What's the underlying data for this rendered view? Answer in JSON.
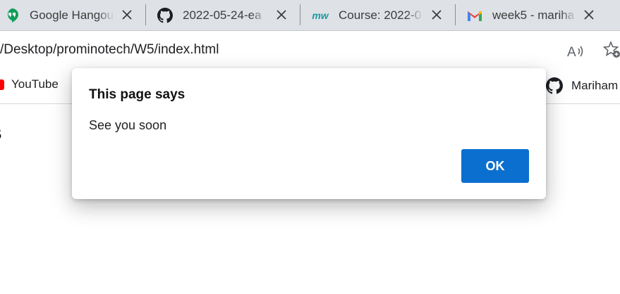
{
  "tabs": [
    {
      "title": "Google Hangouts",
      "icon": "google-hangouts-icon"
    },
    {
      "title": "2022-05-24-ea",
      "icon": "github-icon"
    },
    {
      "title": "Course: 2022-0",
      "icon": "mw-logo-icon",
      "icon_text": "mw"
    },
    {
      "title": "week5 - mariha",
      "icon": "gmail-icon"
    }
  ],
  "address_bar": {
    "url": "/Desktop/prominotech/W5/index.html"
  },
  "bookmarks": [
    {
      "label": "YouTube",
      "icon": "youtube-icon"
    },
    {
      "label": "Mariham",
      "icon": "github-icon"
    }
  ],
  "page": {
    "heading_fragment": "s"
  },
  "dialog": {
    "title": "This page says",
    "message": "See you soon",
    "ok_label": "OK"
  },
  "colors": {
    "ok_button": "#0b6fcf",
    "tab_strip": "#dee1e6",
    "hangouts_green": "#0f9d58",
    "mw_teal": "#1a9aa0"
  }
}
